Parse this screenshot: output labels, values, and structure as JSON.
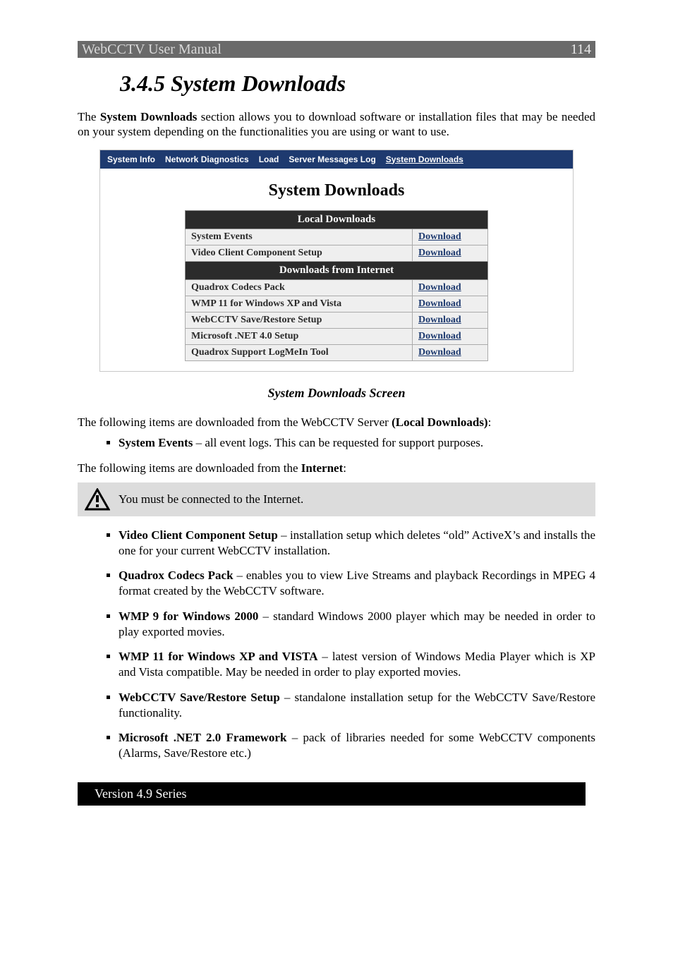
{
  "header": {
    "title": "WebCCTV User Manual",
    "page": "114"
  },
  "heading": "3.4.5 System Downloads",
  "intro": {
    "pre": "The ",
    "bold": "System Downloads",
    "post": " section allows you to download software or installation files that may be needed on your system depending on the functionalities you are using or want to use."
  },
  "screenshot": {
    "tabs": [
      "System Info",
      "Network Diagnostics",
      "Load",
      "Server Messages Log",
      "System Downloads"
    ],
    "active_tab_index": 4,
    "title": "System Downloads",
    "sections": [
      {
        "header": "Local Downloads",
        "rows": [
          {
            "label": "System Events",
            "link": "Download"
          },
          {
            "label": "Video Client Component Setup",
            "link": "Download"
          }
        ]
      },
      {
        "header": "Downloads from Internet",
        "rows": [
          {
            "label": "Quadrox Codecs Pack",
            "link": "Download"
          },
          {
            "label": "WMP 11 for Windows XP and Vista",
            "link": "Download"
          },
          {
            "label": "WebCCTV Save/Restore Setup",
            "link": "Download"
          },
          {
            "label": "Microsoft .NET 4.0 Setup",
            "link": "Download"
          },
          {
            "label": "Quadrox Support LogMeIn Tool",
            "link": "Download"
          }
        ]
      }
    ]
  },
  "caption": "System Downloads Screen",
  "local_intro": {
    "pre": "The following items are downloaded from the WebCCTV Server ",
    "bold": "(Local Downloads)",
    "post": ":"
  },
  "local_item": {
    "bold": "System Events",
    "text": " – all event logs. This can be requested for support purposes."
  },
  "internet_intro": {
    "pre": "The following items are downloaded from the ",
    "bold": "Internet",
    "post": ":"
  },
  "note": "You must be connected to the Internet.",
  "internet_items": [
    {
      "bold": "Video Client Component Setup",
      "text": " – installation setup which deletes “old” ActiveX’s and installs the one for your current WebCCTV installation."
    },
    {
      "bold": "Quadrox Codecs Pack",
      "text": " – enables you to view Live Streams and playback Recordings in MPEG 4 format created by the WebCCTV software."
    },
    {
      "bold": "WMP 9 for Windows 2000",
      "text": " – standard Windows 2000 player which may be needed in order to play exported movies."
    },
    {
      "bold": "WMP 11 for Windows XP and VISTA",
      "text": " – latest version of Windows Media Player which is XP and Vista compatible. May be needed in order to play exported movies."
    },
    {
      "bold": "WebCCTV Save/Restore Setup",
      "text": " – standalone installation setup for the WebCCTV Save/Restore functionality."
    },
    {
      "bold": "Microsoft .NET 2.0 Framework",
      "text": " – pack of libraries needed for some WebCCTV components (Alarms, Save/Restore etc.)"
    }
  ],
  "footer": "Version 4.9 Series"
}
